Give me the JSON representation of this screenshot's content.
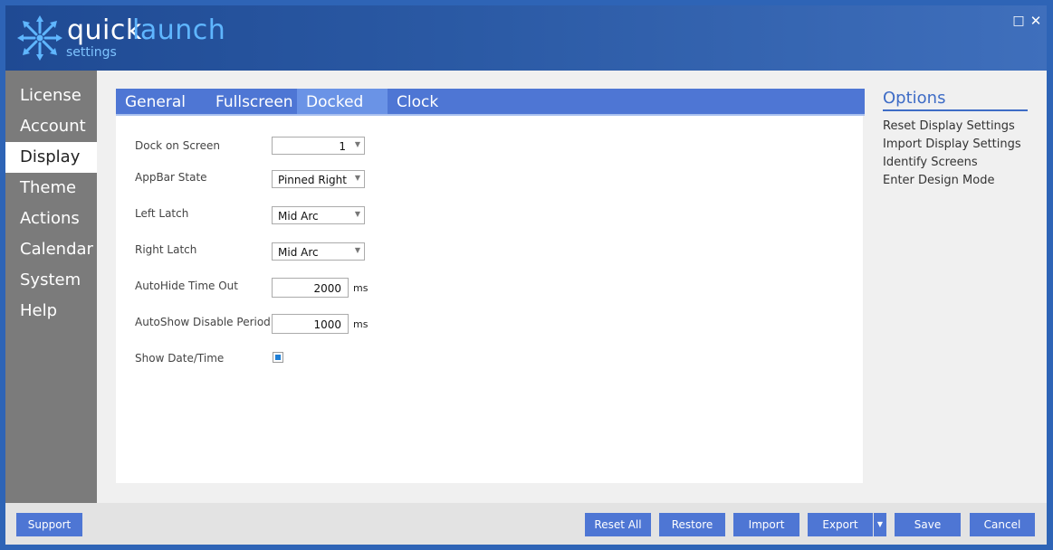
{
  "app": {
    "brand_part1": "quick",
    "brand_part2": "launch",
    "subtitle": "settings",
    "logo": "starburst-arrows-icon",
    "window_controls": {
      "maximize": "□",
      "close": "✕"
    }
  },
  "sidebar": {
    "items": [
      {
        "label": "License"
      },
      {
        "label": "Account"
      },
      {
        "label": "Display",
        "active": true
      },
      {
        "label": "Theme"
      },
      {
        "label": "Actions"
      },
      {
        "label": "Calendar"
      },
      {
        "label": "System"
      },
      {
        "label": "Help"
      }
    ]
  },
  "tabs": [
    {
      "label": "General"
    },
    {
      "label": "Fullscreen"
    },
    {
      "label": "Docked",
      "active": true
    },
    {
      "label": "Clock"
    }
  ],
  "form": {
    "dock_on_screen": {
      "label": "Dock on Screen",
      "value": "1"
    },
    "appbar_state": {
      "label": "AppBar State",
      "value": "Pinned Right"
    },
    "left_latch": {
      "label": "Left Latch",
      "value": "Mid Arc"
    },
    "right_latch": {
      "label": "Right Latch",
      "value": "Mid Arc"
    },
    "autohide_timeout": {
      "label": "AutoHide Time Out",
      "value": "2000",
      "unit": "ms"
    },
    "autoshow_disable": {
      "label": "AutoShow Disable Period",
      "value": "1000",
      "unit": "ms"
    },
    "show_datetime": {
      "label": "Show Date/Time",
      "checked": true
    }
  },
  "options": {
    "title": "Options",
    "links": [
      "Reset Display Settings",
      "Import Display Settings",
      "Identify Screens",
      "Enter Design Mode"
    ]
  },
  "footer": {
    "support": "Support",
    "reset_all": "Reset All",
    "restore": "Restore",
    "import": "Import",
    "export": "Export",
    "save": "Save",
    "cancel": "Cancel"
  },
  "colors": {
    "titlebar": "#2b5aa5",
    "accent": "#4e76d4",
    "tab_active": "#6a93e6",
    "sidebar": "#7b7b7b",
    "options_title": "#3e6cc6"
  }
}
